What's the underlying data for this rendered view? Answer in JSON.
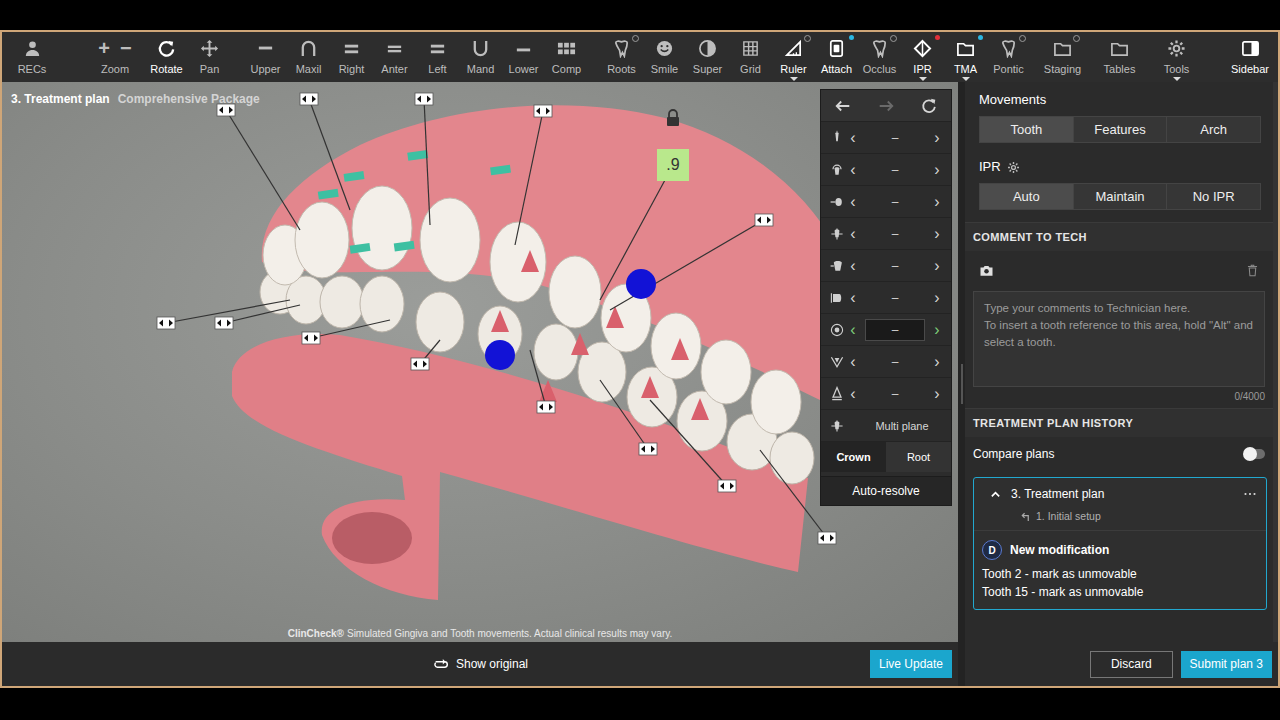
{
  "toolbar": {
    "groups": [
      {
        "items": [
          {
            "label": "RECs",
            "glyphs": [],
            "selected": false,
            "menu": false,
            "badge": null
          }
        ]
      },
      {
        "items": [
          {
            "label": "Zoom",
            "glyphs": [
              "+",
              "−"
            ],
            "selected": false,
            "menu": false,
            "badge": null
          },
          {
            "label": "Rotate",
            "glyphs": [],
            "selected": true,
            "menu": false,
            "badge": null
          },
          {
            "label": "Pan",
            "glyphs": [],
            "selected": false,
            "menu": false,
            "badge": null
          }
        ]
      },
      {
        "items": [
          {
            "label": "Upper",
            "glyphs": [],
            "selected": false,
            "menu": false,
            "badge": null
          },
          {
            "label": "Maxil",
            "glyphs": [],
            "selected": false,
            "menu": false,
            "badge": null
          },
          {
            "label": "Right",
            "glyphs": [],
            "selected": false,
            "menu": false,
            "badge": null
          },
          {
            "label": "Anter",
            "glyphs": [],
            "selected": false,
            "menu": false,
            "badge": null
          },
          {
            "label": "Left",
            "glyphs": [],
            "selected": false,
            "menu": false,
            "badge": null
          },
          {
            "label": "Mand",
            "glyphs": [],
            "selected": false,
            "menu": false,
            "badge": null
          },
          {
            "label": "Lower",
            "glyphs": [],
            "selected": false,
            "menu": false,
            "badge": null
          },
          {
            "label": "Comp",
            "glyphs": [],
            "selected": false,
            "menu": false,
            "badge": null
          }
        ]
      },
      {
        "items": [
          {
            "label": "Roots",
            "glyphs": [],
            "selected": false,
            "menu": false,
            "badge": {
              "kind": "ring",
              "color": "#9a9a9a"
            }
          },
          {
            "label": "Smile",
            "glyphs": [],
            "selected": false,
            "menu": false,
            "badge": null
          },
          {
            "label": "Super",
            "glyphs": [],
            "selected": false,
            "menu": false,
            "badge": null
          },
          {
            "label": "Grid",
            "glyphs": [],
            "selected": false,
            "menu": false,
            "badge": null
          },
          {
            "label": "Ruler",
            "glyphs": [],
            "selected": true,
            "menu": true,
            "badge": {
              "kind": "ring",
              "color": "#9a9a9a"
            }
          },
          {
            "label": "Attach",
            "glyphs": [],
            "selected": true,
            "menu": false,
            "badge": {
              "kind": "dot",
              "color": "#2bb7e3"
            }
          },
          {
            "label": "Occlus",
            "glyphs": [],
            "selected": false,
            "menu": false,
            "badge": {
              "kind": "ring",
              "color": "#9a9a9a"
            }
          },
          {
            "label": "IPR",
            "glyphs": [],
            "selected": true,
            "menu": true,
            "badge": {
              "kind": "dot",
              "color": "#e0303a"
            }
          },
          {
            "label": "TMA",
            "glyphs": [],
            "selected": true,
            "menu": true,
            "badge": {
              "kind": "dot",
              "color": "#2bb7e3"
            }
          },
          {
            "label": "Pontic",
            "glyphs": [],
            "selected": false,
            "menu": false,
            "badge": {
              "kind": "ring",
              "color": "#9a9a9a"
            }
          }
        ]
      },
      {
        "items": [
          {
            "label": "Staging",
            "glyphs": [],
            "selected": false,
            "menu": false,
            "badge": {
              "kind": "ring",
              "color": "#9a9a9a"
            }
          },
          {
            "label": "Tables",
            "glyphs": [],
            "selected": false,
            "menu": false,
            "badge": null
          },
          {
            "label": "Tools",
            "glyphs": [],
            "selected": false,
            "menu": true,
            "badge": null
          }
        ]
      },
      {
        "items": [
          {
            "label": "Sidebar",
            "glyphs": [],
            "selected": true,
            "menu": false,
            "badge": null
          }
        ]
      }
    ]
  },
  "viewport": {
    "title": "3. Treatment plan",
    "subtitle": "Comprehensive Package",
    "locked": true,
    "ipr_label": ".9",
    "brand": "ClinCheck®",
    "disclaimer": "Simulated Gingiva and Tooth movements. Actual clinical results may vary."
  },
  "controls": {
    "history": [
      {
        "disabled": false
      },
      {
        "disabled": true
      },
      {
        "disabled": false
      }
    ],
    "prev": "‹",
    "next": "›",
    "rows": [
      {
        "value": "–",
        "selected": false
      },
      {
        "value": "–",
        "selected": false
      },
      {
        "value": "–",
        "selected": false
      },
      {
        "value": "–",
        "selected": false
      },
      {
        "value": "–",
        "selected": false
      },
      {
        "value": "–",
        "selected": false
      },
      {
        "value": "–",
        "selected": true
      },
      {
        "value": "–",
        "selected": false
      },
      {
        "value": "–",
        "selected": false
      }
    ],
    "multi_plane": "Multi plane",
    "modes": [
      {
        "label": "Crown",
        "selected": true
      },
      {
        "label": "Root",
        "selected": false
      }
    ],
    "auto_resolve": "Auto-resolve"
  },
  "bottom": {
    "show_original": "Show original",
    "live_update": "Live Update"
  },
  "sidebar": {
    "movements": {
      "title": "Movements",
      "options": [
        {
          "label": "Tooth",
          "selected": true
        },
        {
          "label": "Features",
          "selected": false
        },
        {
          "label": "Arch",
          "selected": false
        }
      ]
    },
    "ipr": {
      "title": "IPR",
      "options": [
        {
          "label": "Auto",
          "selected": true
        },
        {
          "label": "Maintain",
          "selected": false
        },
        {
          "label": "No IPR",
          "selected": false
        }
      ]
    },
    "comment": {
      "header": "COMMENT TO TECH",
      "placeholder": "Type your comments to Technician here.\nTo insert a tooth reference to this area, hold \"Alt\" and select a tooth.",
      "counter": "0/4000"
    },
    "history": {
      "header": "TREATMENT PLAN HISTORY",
      "compare_label": "Compare plans",
      "compare_on": false,
      "plans": [
        {
          "title": "3. Treatment plan",
          "based_on": "1. Initial setup",
          "expanded": true,
          "author": "D",
          "modification": "New modification",
          "changes": [
            "Tooth 2 - mark as unmovable",
            "Tooth 15 - mark as unmovable"
          ]
        }
      ]
    },
    "actions": {
      "discard": "Discard",
      "submit": "Submit plan 3"
    }
  }
}
